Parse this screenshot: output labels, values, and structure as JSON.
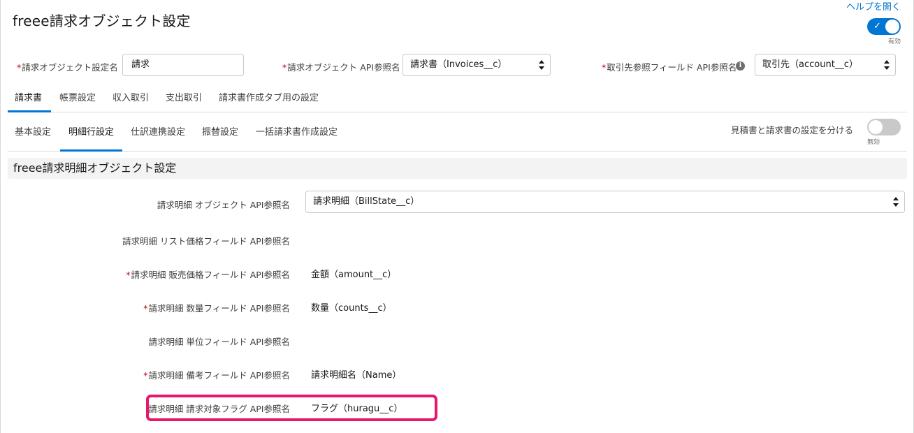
{
  "header": {
    "title": "freee請求オブジェクト設定",
    "help_link": "ヘルプを開く",
    "enabled_toggle_label": "有効"
  },
  "top_fields": {
    "object_name_label": "請求オブジェクト設定名",
    "object_name_value": "請求",
    "object_api_label": "請求オブジェクト API参照名",
    "object_api_value": "請求書（Invoices__c）",
    "account_ref_label": "取引先参照フィールド API参照名",
    "account_ref_value": "取引先（account__c）"
  },
  "main_tabs": [
    {
      "label": "請求書",
      "active": true
    },
    {
      "label": "帳票設定",
      "active": false
    },
    {
      "label": "収入取引",
      "active": false
    },
    {
      "label": "支出取引",
      "active": false
    },
    {
      "label": "請求書作成タブ用の設定",
      "active": false
    }
  ],
  "sub_tabs": [
    {
      "label": "基本設定",
      "active": false
    },
    {
      "label": "明細行設定",
      "active": true
    },
    {
      "label": "仕訳連携設定",
      "active": false
    },
    {
      "label": "振替設定",
      "active": false
    },
    {
      "label": "一括請求書作成設定",
      "active": false
    }
  ],
  "separate_settings": {
    "label": "見積書と請求書の設定を分ける",
    "toggle_label": "無効"
  },
  "section": {
    "title": "freee請求明細オブジェクト設定"
  },
  "detail_fields": [
    {
      "label": "請求明細 オブジェクト API参照名",
      "value": "請求明細（BillState__c）",
      "required": false
    },
    {
      "label": "請求明細 リスト価格フィールド API参照名",
      "value": "",
      "required": false
    },
    {
      "label": "請求明細 販売価格フィールド API参照名",
      "value": "金額（amount__c）",
      "required": true
    },
    {
      "label": "請求明細 数量フィールド API参照名",
      "value": "数量（counts__c）",
      "required": true
    },
    {
      "label": "請求明細 単位フィールド API参照名",
      "value": "",
      "required": false
    },
    {
      "label": "請求明細 備考フィールド API参照名",
      "value": "請求明細名（Name）",
      "required": true
    },
    {
      "label": "請求明細 請求対象フラグ API参照名",
      "value": "フラグ（huragu__c）",
      "required": false
    }
  ],
  "colors": {
    "brand_blue": "#0176d3",
    "required_red": "#ba0517",
    "highlight_pink": "#e8166e"
  }
}
